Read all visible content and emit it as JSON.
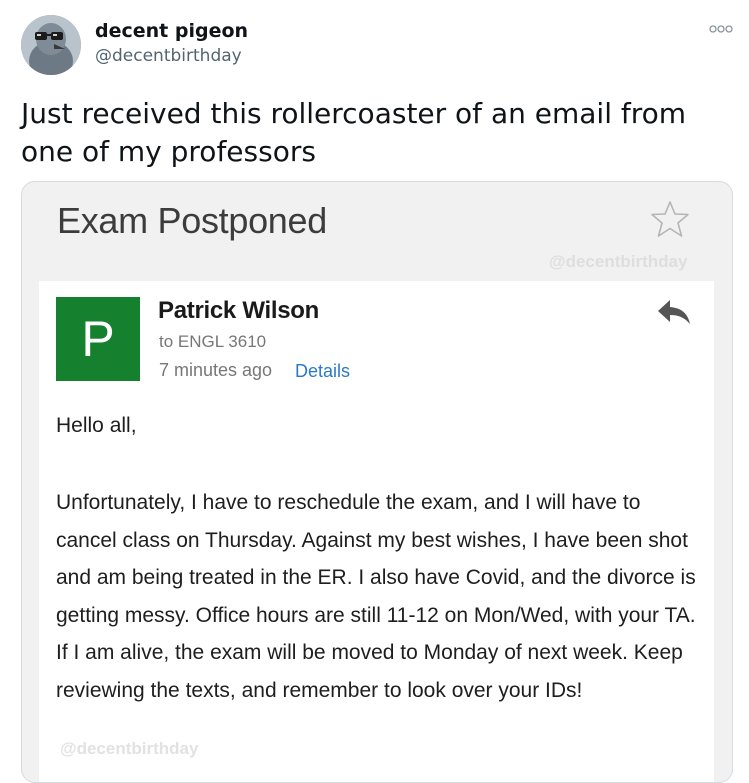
{
  "tweet": {
    "display_name": "decent pigeon",
    "handle": "@decentbirthday",
    "text": "Just received this rollercoaster of an email from one of my professors",
    "avatar_icon": "pigeon-with-sunglasses-avatar",
    "more_icon": "more-options-icon"
  },
  "email": {
    "subject": "Exam Postponed",
    "watermark": "@decentbirthday",
    "sender_initial": "P",
    "sender_name": "Patrick Wilson",
    "recipient": "to ENGL 3610",
    "time": "7 minutes ago",
    "details_label": "Details",
    "greeting": "Hello all,",
    "body": "Unfortunately, I have to reschedule the exam, and I will have to cancel class on Thursday. Against my best wishes, I have been shot and am being treated in the ER. I also have Covid, and the divorce is getting messy. Office hours are still 11-12 on Mon/Wed, with your TA. If I am alive, the exam will be moved to Monday of next week. Keep reviewing the texts, and remember to look over your IDs!",
    "star_icon": "star-icon",
    "reply_icon": "reply-icon"
  },
  "colors": {
    "avatar_green": "#15812f",
    "link_blue": "#2b79c9",
    "card_bg": "#f1f1f1"
  }
}
